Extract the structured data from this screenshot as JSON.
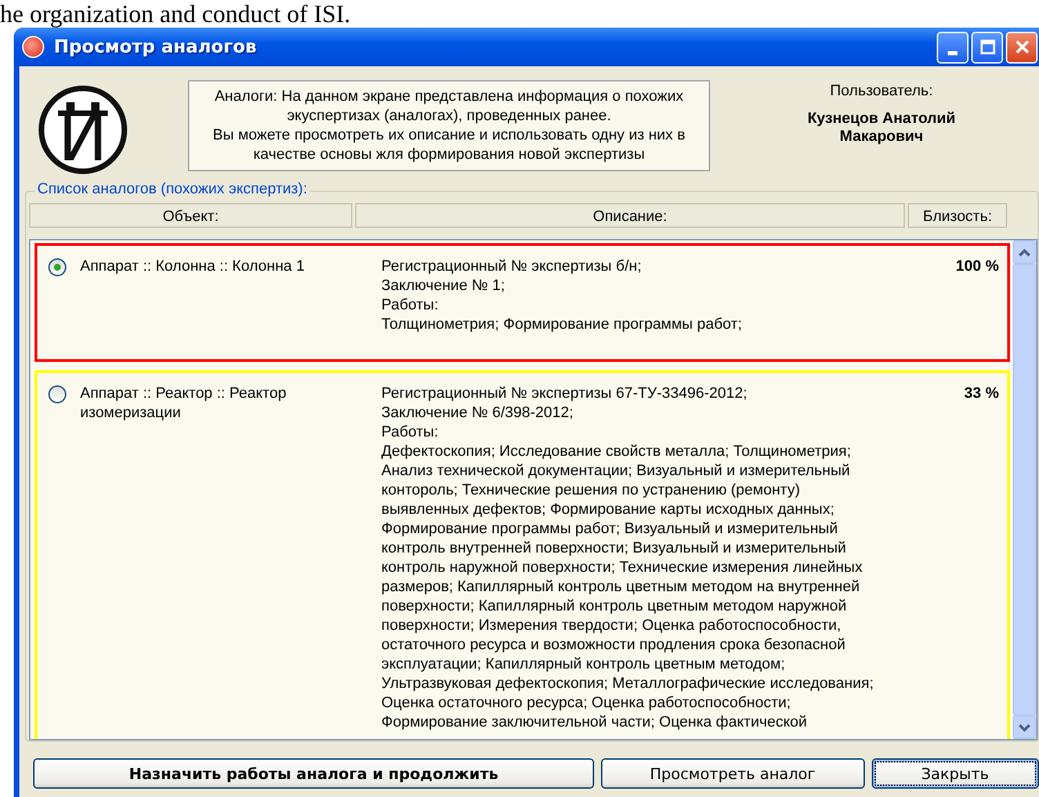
{
  "document_text": "he organization and conduct of ISI.",
  "window": {
    "title": "Просмотр аналогов"
  },
  "header": {
    "logo_letter": "И",
    "info": [
      "Аналоги: На данном экране представлена информация о похожих",
      "экуспертизах (аналогах), проведенных ранее.",
      "Вы можете просмотреть их описание и использовать одну из них в",
      "качестве основы жля формирования новой экспертизы"
    ],
    "user_label": "Пользователь:",
    "user_name": "Кузнецов Анатолий Макарович"
  },
  "analogs": {
    "title": "Список аналогов (похожих экспертиз):",
    "columns": [
      "Объект:",
      "Описание:",
      "Близость:"
    ],
    "rows": [
      {
        "selected": true,
        "color": "#ff0000",
        "object": "Аппарат :: Колонна :: Колонна 1",
        "similarity": "100 %",
        "description": [
          "Регистрационный № экспертизы б/н;",
          "Заключение № 1;",
          "Работы:",
          "Толщинометрия; Формирование программы работ;"
        ]
      },
      {
        "selected": false,
        "color": "#ffff00",
        "object": "Аппарат :: Реактор :: Реактор изомеризации",
        "similarity": "33 %",
        "description": [
          "Регистрационный № экспертизы 67-ТУ-33496-2012;",
          "Заключение № 6/398-2012;",
          "Работы:",
          "Дефектоскопия; Исследование свойств металла; Толщинометрия;",
          "Анализ технической документации; Визуальный и измерительный",
          "контороль; Технические решения по устранению (ремонту)",
          "выявленных дефектов; Формирование карты исходных данных;",
          "Формирование программы работ; Визуальный и измерительный",
          "контроль внутренней поверхности; Визуальный и измерительный",
          "контроль наружной поверхности; Технические измерения линейных",
          "размеров; Капиллярный контроль цветным методом на внутренней",
          "поверхности; Капиллярный контроль цветным методом наружной",
          "поверхности; Измерения твердости; Оценка работоспособности,",
          "остаточного ресурса и возможности продления срока безопасной",
          "эксплуатации; Капиллярный контроль цветным методом;",
          "Ультразвуковая дефектоскопия; Металлографические исследования;",
          "Оценка остаточного ресурса; Оценка работоспособности;",
          "Формирование заключительной части; Оценка фактической"
        ]
      }
    ]
  },
  "buttons": [
    {
      "label": "Назначить работы аналога и продолжить",
      "kind": "primary"
    },
    {
      "label": "Просмотреть аналог",
      "kind": "normal"
    },
    {
      "label": "Закрыть",
      "kind": "focused"
    }
  ]
}
